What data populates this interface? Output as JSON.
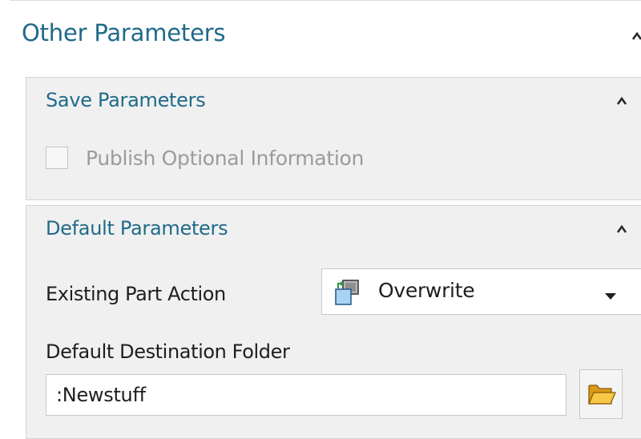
{
  "panel": {
    "title": "Other Parameters",
    "collapse_icon": "chevron-up-icon"
  },
  "save_parameters": {
    "title": "Save Parameters",
    "collapse_icon": "chevron-up-icon",
    "publish_optional_information": {
      "label": "Publish Optional Information",
      "checked": false,
      "enabled": false
    }
  },
  "default_parameters": {
    "title": "Default Parameters",
    "collapse_icon": "chevron-up-icon",
    "existing_part_action": {
      "label": "Existing Part Action",
      "value": "Overwrite",
      "icon": "overwrite-icon",
      "dropdown_icon": "triangle-down-icon"
    },
    "default_destination_folder": {
      "label": "Default Destination Folder",
      "value": ":Newstuff",
      "browse_icon": "folder-open-icon"
    }
  },
  "colors": {
    "heading": "#1f6a8a",
    "group_background": "#f0f0f0",
    "disabled_text": "#9b9b9b",
    "folder_icon": "#f2b630"
  }
}
